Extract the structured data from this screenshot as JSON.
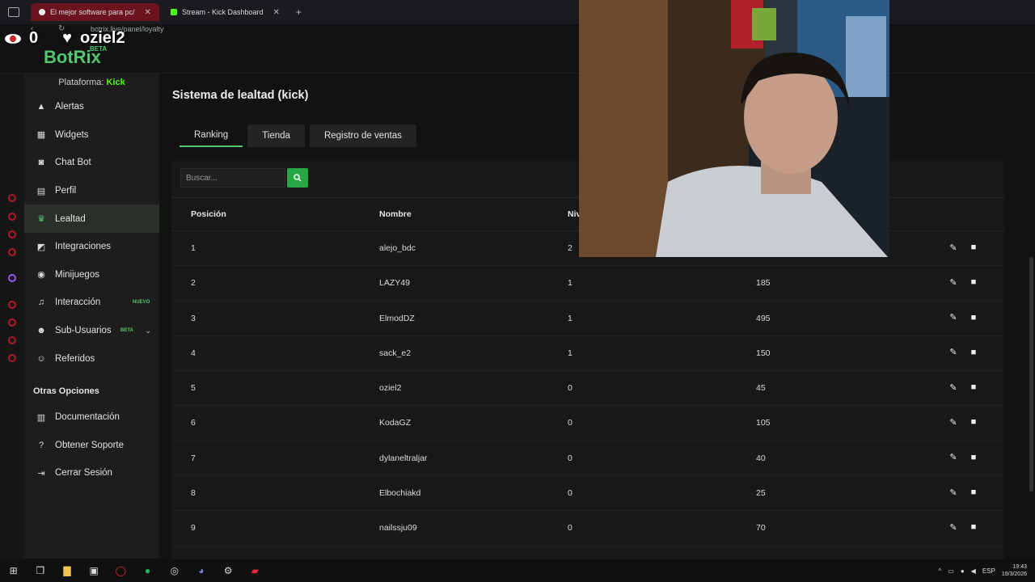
{
  "browser": {
    "tabs": [
      {
        "label": "El mejor software para pc/",
        "active": true
      },
      {
        "label": "Stream - Kick Dashboard",
        "active": false
      }
    ],
    "url": "botrix.live/panel/loyalty"
  },
  "overlay": {
    "viewers": "0",
    "follower_name": "oziel2"
  },
  "brand": {
    "name": "BotRix",
    "tag": "BETA"
  },
  "sidebar": {
    "platform_label": "Plataforma:",
    "platform_value": "Kick",
    "items": [
      {
        "label": "Alertas",
        "icon": "warning-icon",
        "badge": "",
        "active": false
      },
      {
        "label": "Widgets",
        "icon": "widgets-icon",
        "badge": "",
        "active": false
      },
      {
        "label": "Chat Bot",
        "icon": "robot-icon",
        "badge": "",
        "active": false
      },
      {
        "label": "Perfil",
        "icon": "profile-icon",
        "badge": "",
        "active": false
      },
      {
        "label": "Lealtad",
        "icon": "trophy-icon",
        "badge": "",
        "active": true
      },
      {
        "label": "Integraciones",
        "icon": "integrations-icon",
        "badge": "",
        "active": false
      },
      {
        "label": "Minijuegos",
        "icon": "gamepad-icon",
        "badge": "",
        "active": false
      },
      {
        "label": "Interacción",
        "icon": "music-icon",
        "badge": "NUEVO",
        "active": false
      },
      {
        "label": "Sub-Usuarios",
        "icon": "users-icon",
        "badge": "BETA",
        "active": false
      },
      {
        "label": "Referidos",
        "icon": "referrals-icon",
        "badge": "",
        "active": false
      }
    ],
    "other_title": "Otras Opciones",
    "other_items": [
      {
        "label": "Documentación",
        "icon": "document-icon"
      },
      {
        "label": "Obtener Soporte",
        "icon": "help-icon"
      },
      {
        "label": "Cerrar Sesión",
        "icon": "logout-icon"
      }
    ]
  },
  "main": {
    "title": "Sistema de lealtad (kick)",
    "tabs": [
      {
        "label": "Ranking",
        "active": true
      },
      {
        "label": "Tienda",
        "active": false
      },
      {
        "label": "Registro de ventas",
        "active": false
      }
    ],
    "search_placeholder": "Buscar...",
    "columns": [
      "Posición",
      "Nombre",
      "Nivel"
    ],
    "rows": [
      {
        "pos": "1",
        "name": "alejo_bdc",
        "level": "2",
        "points": ""
      },
      {
        "pos": "2",
        "name": "LAZY49",
        "level": "1",
        "points": "185"
      },
      {
        "pos": "3",
        "name": "ElmodDZ",
        "level": "1",
        "points": "495"
      },
      {
        "pos": "4",
        "name": "sack_e2",
        "level": "1",
        "points": "150"
      },
      {
        "pos": "5",
        "name": "oziel2",
        "level": "0",
        "points": "45"
      },
      {
        "pos": "6",
        "name": "KodaGZ",
        "level": "0",
        "points": "105"
      },
      {
        "pos": "7",
        "name": "dylaneltraljar",
        "level": "0",
        "points": "40"
      },
      {
        "pos": "8",
        "name": "Elbochiakd",
        "level": "0",
        "points": "25"
      },
      {
        "pos": "9",
        "name": "nailssju09",
        "level": "0",
        "points": "70"
      }
    ]
  },
  "taskbar": {
    "lang": "ESP",
    "time": "19:43",
    "date": "19/3/2026"
  },
  "colors": {
    "accent": "#53c66f",
    "kick": "#53fc18",
    "search_button": "#28a745",
    "active_tab_browser": "#6b1420"
  }
}
